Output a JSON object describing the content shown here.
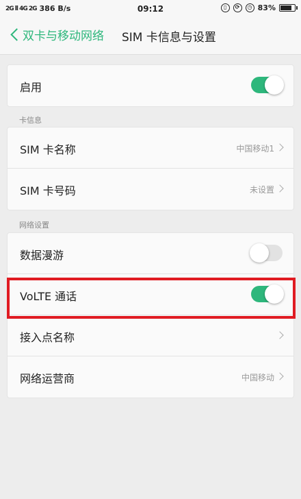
{
  "status_bar": {
    "signal_text": "2G ll 4G 2G",
    "net_speed": "386 B/s",
    "time": "09:12",
    "battery": "83%",
    "battery_level": 0.83
  },
  "header": {
    "back_label": "双卡与移动网络",
    "title": "SIM 卡信息与设置"
  },
  "enable_card": {
    "label": "启用",
    "toggle_on": true
  },
  "card_info": {
    "section_label": "卡信息",
    "rows": [
      {
        "label": "SIM 卡名称",
        "value": "中国移动1"
      },
      {
        "label": "SIM 卡号码",
        "value": "未设置"
      }
    ]
  },
  "network": {
    "section_label": "网络设置",
    "data_roaming": {
      "label": "数据漫游",
      "toggle_on": false
    },
    "volte": {
      "label": "VoLTE 通话",
      "toggle_on": true
    },
    "apn": {
      "label": "接入点名称"
    },
    "operator": {
      "label": "网络运营商",
      "value": "中国移动"
    }
  },
  "colors": {
    "accent": "#2eb77c",
    "highlight": "#e01b22"
  }
}
